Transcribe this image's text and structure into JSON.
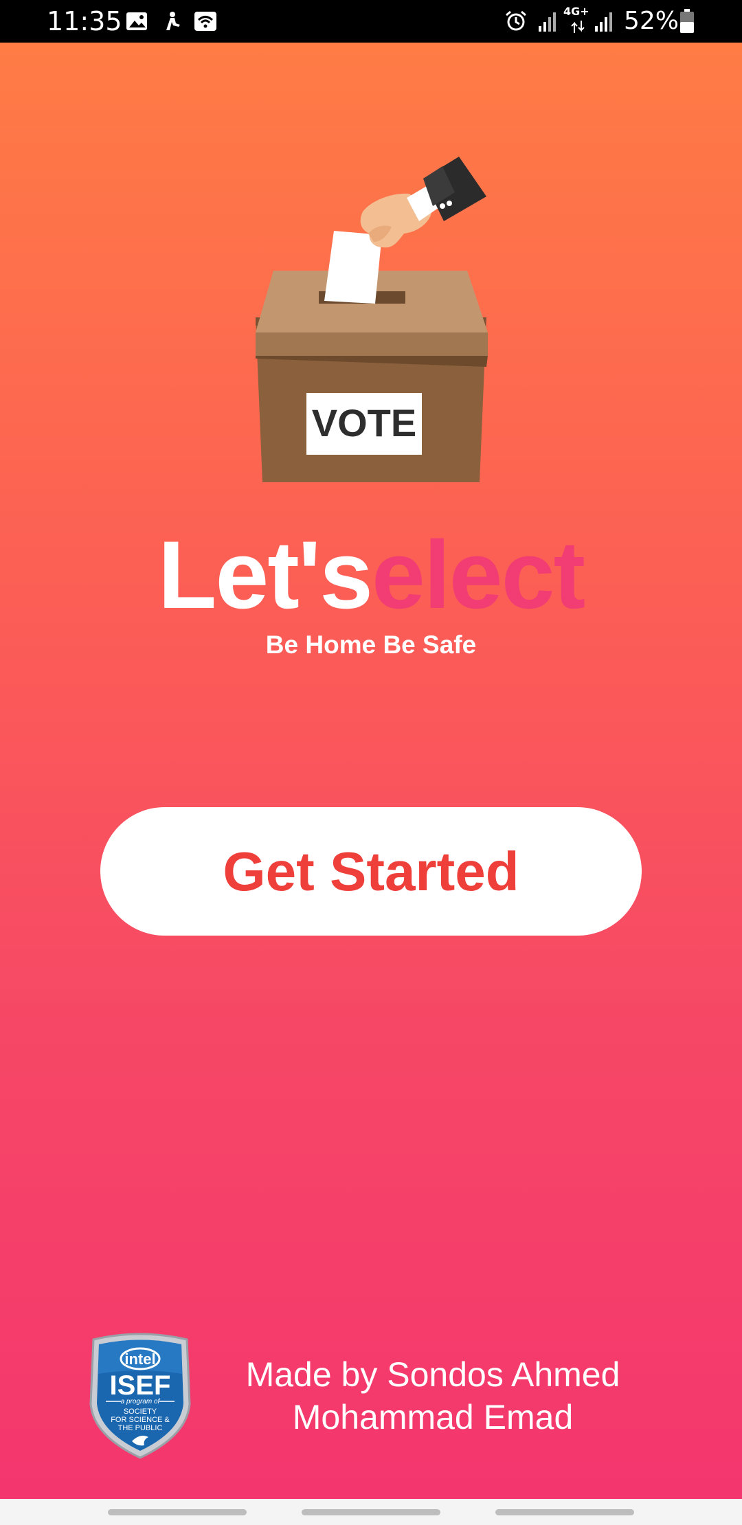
{
  "status_bar": {
    "time": "11:35",
    "network": "4G+",
    "battery": "52%",
    "icons": [
      "image-icon",
      "notification-icon",
      "wifi-hotspot-icon",
      "alarm-icon",
      "signal-icon",
      "signal-icon",
      "battery-icon"
    ]
  },
  "illustration": {
    "box_label": "VOTE"
  },
  "app": {
    "title_part1": "Let's",
    "title_part2": "elect",
    "subtitle": "Be Home Be Safe"
  },
  "buttons": {
    "get_started": "Get Started"
  },
  "footer": {
    "badge": {
      "brand": "intel",
      "name": "ISEF",
      "program": "a program of",
      "org_line1": "SOCIETY",
      "org_line2": "FOR SCIENCE &",
      "org_line3": "THE PUBLIC"
    },
    "credit_line1": "Made by Sondos Ahmed",
    "credit_line2": "Mohammad Emad"
  },
  "colors": {
    "gradient_top": "#ff7c45",
    "gradient_bottom": "#f4366e",
    "accent_pink": "#f23d74",
    "button_text": "#ee3f3a"
  }
}
